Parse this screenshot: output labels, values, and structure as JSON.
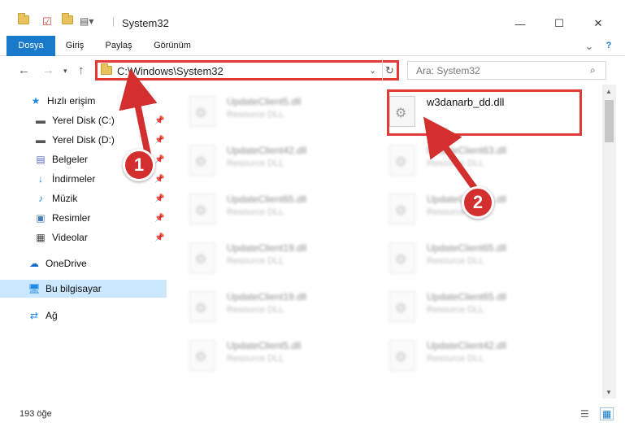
{
  "window": {
    "title": "System32",
    "minimize": "—",
    "maximize": "☐",
    "close": "✕"
  },
  "ribbon": {
    "tabs": [
      "Dosya",
      "Giriş",
      "Paylaş",
      "Görünüm"
    ],
    "expand": "⌄",
    "help": "?"
  },
  "address": {
    "path": "C:\\Windows\\System32",
    "search_placeholder": "Ara: System32"
  },
  "navpane": {
    "items": [
      {
        "label": "Hızlı erişim",
        "icon": "star-icon",
        "pinned": false
      },
      {
        "label": "Yerel Disk (C:)",
        "icon": "drive-icon",
        "pinned": true
      },
      {
        "label": "Yerel Disk (D:)",
        "icon": "drive-icon",
        "pinned": true
      },
      {
        "label": "Belgeler",
        "icon": "documents-icon",
        "pinned": true
      },
      {
        "label": "İndirmeler",
        "icon": "downloads-icon",
        "pinned": true
      },
      {
        "label": "Müzik",
        "icon": "music-icon",
        "pinned": true
      },
      {
        "label": "Resimler",
        "icon": "pictures-icon",
        "pinned": true
      },
      {
        "label": "Videolar",
        "icon": "videos-icon",
        "pinned": true
      },
      {
        "label": "OneDrive",
        "icon": "onedrive-icon",
        "pinned": false
      },
      {
        "label": "Bu bilgisayar",
        "icon": "computer-icon",
        "pinned": false
      },
      {
        "label": "Ağ",
        "icon": "network-icon",
        "pinned": false
      }
    ]
  },
  "files": {
    "highlighted": {
      "name": "w3danarb_dd.dll",
      "type": ""
    },
    "left_column": [
      {
        "name": "UpdateClient5.dll",
        "type": "Resource DLL"
      },
      {
        "name": "UpdateClient42.dll",
        "type": "Resource DLL"
      },
      {
        "name": "UpdateClient65.dll",
        "type": "Resource DLL"
      },
      {
        "name": "UpdateClient19.dll",
        "type": "Resource DLL"
      },
      {
        "name": "UpdateClient19.dll",
        "type": "Resource DLL"
      },
      {
        "name": "UpdateClient5.dll",
        "type": "Resource DLL"
      }
    ],
    "right_column": [
      {
        "name": "UpdateClient63.dll",
        "type": "Resource DLL"
      },
      {
        "name": "UpdateClient42.dll",
        "type": "Resource DLL"
      },
      {
        "name": "UpdateClient65.dll",
        "type": "Resource DLL"
      },
      {
        "name": "UpdateClient65.dll",
        "type": "Resource DLL"
      },
      {
        "name": "UpdateClient42.dll",
        "type": "Resource DLL"
      }
    ]
  },
  "status": {
    "count": "193 öğe"
  },
  "annotations": {
    "step1": "1",
    "step2": "2",
    "color": "#d32f2f"
  }
}
